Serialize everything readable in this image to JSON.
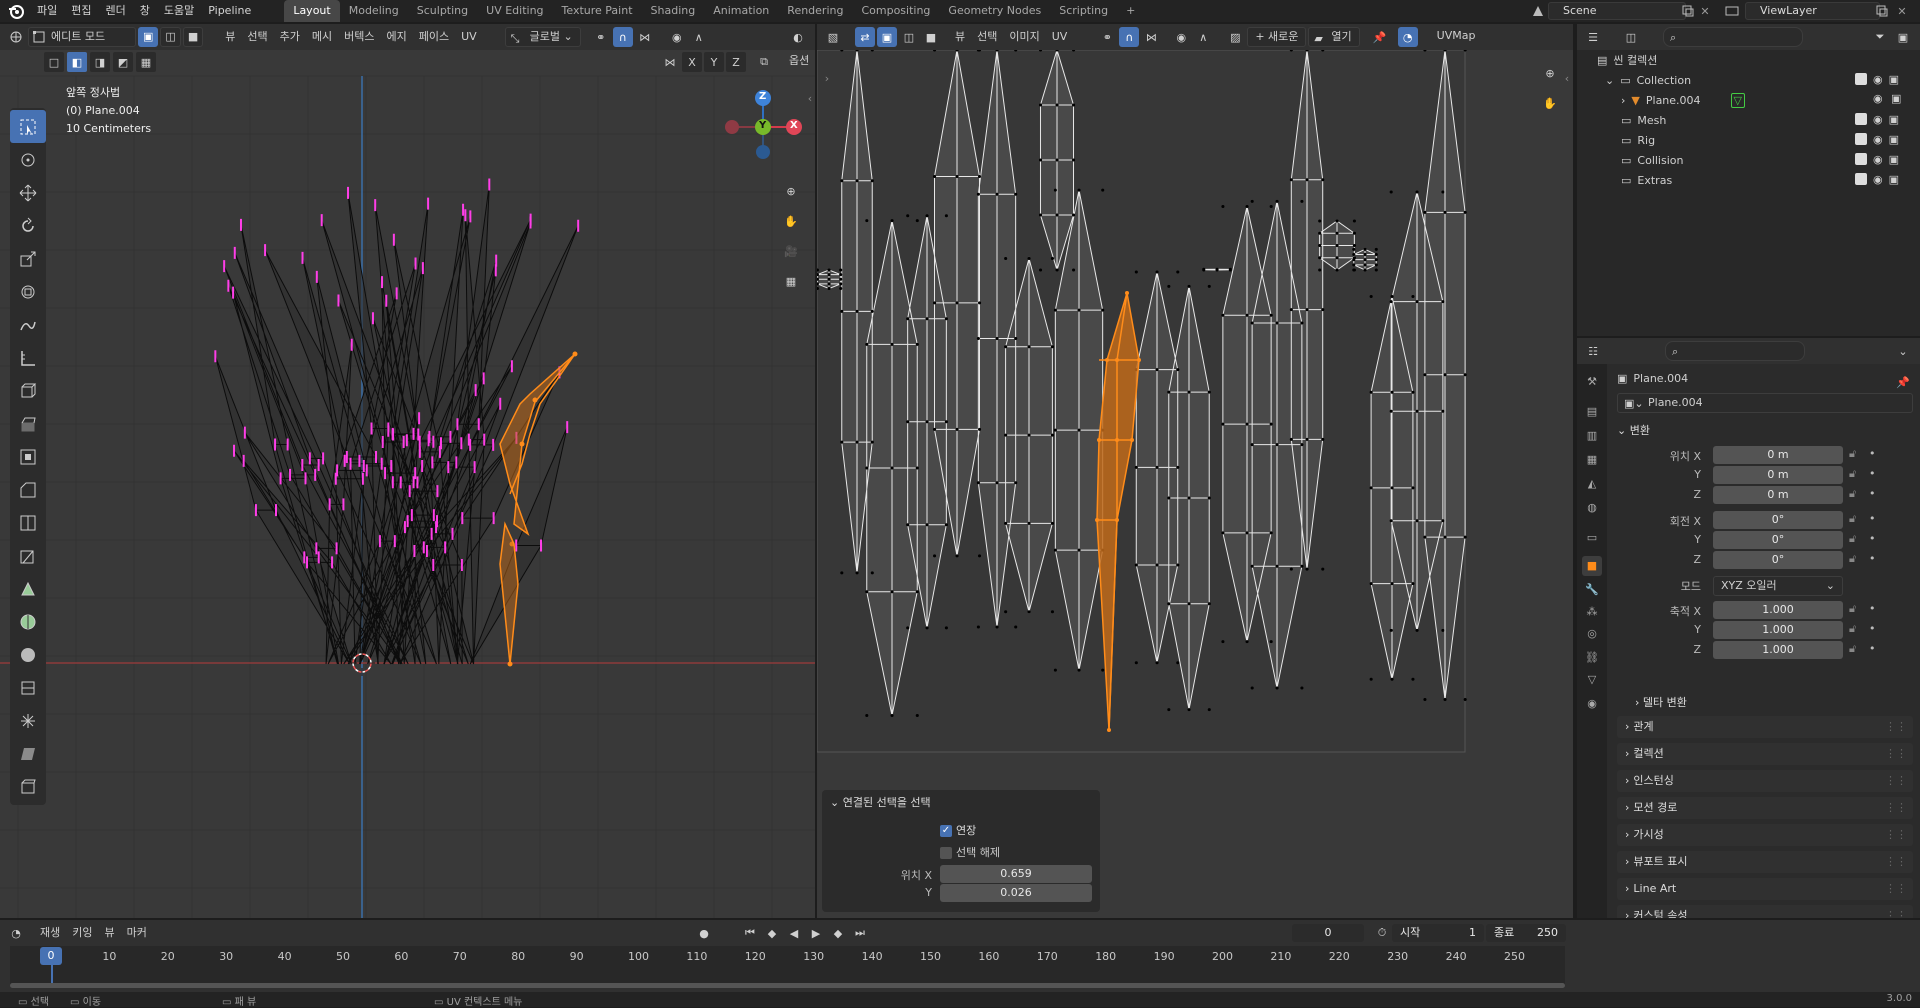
{
  "topbar": {
    "menus": [
      "파일",
      "편집",
      "렌더",
      "창",
      "도움말",
      "Pipeline"
    ],
    "workspaces": [
      "Layout",
      "Modeling",
      "Sculpting",
      "UV Editing",
      "Texture Paint",
      "Shading",
      "Animation",
      "Rendering",
      "Compositing",
      "Geometry Nodes",
      "Scripting"
    ],
    "active_workspace": "Layout",
    "add_tab": "+",
    "scene": "Scene",
    "view_layer": "ViewLayer"
  },
  "viewport": {
    "mode": "에디트 모드",
    "menus": [
      "뷰",
      "선택",
      "추가",
      "메시",
      "버텍스",
      "에지",
      "페이스",
      "UV"
    ],
    "transform_orientation": "글로벌",
    "options": "옵션",
    "axes": [
      "X",
      "Y",
      "Z"
    ],
    "overlay_title": "앞쪽 정사법",
    "overlay_object": "(0) Plane.004",
    "overlay_scale": "10 Centimeters",
    "gizmo": {
      "z": "Z",
      "y": "Y",
      "x": "X"
    }
  },
  "uv_editor": {
    "menus": [
      "뷰",
      "선택",
      "이미지",
      "UV"
    ],
    "new_btn": "+ 새로운",
    "open_btn": "열기",
    "uvmap": "UVMap"
  },
  "redo_panel": {
    "title": "연결된 선택을 선택",
    "extend_label": "연장",
    "extend_checked": true,
    "deselect_label": "선택 해제",
    "deselect_checked": false,
    "loc_x_label": "위치 X",
    "loc_x": "0.659",
    "loc_y_label": "Y",
    "loc_y": "0.026"
  },
  "outliner": {
    "scene_collection": "씬 컬렉션",
    "rows": [
      {
        "label": "Collection"
      },
      {
        "label": "Plane.004"
      },
      {
        "label": "Mesh"
      },
      {
        "label": "Rig"
      },
      {
        "label": "Collision"
      },
      {
        "label": "Extras"
      }
    ]
  },
  "properties": {
    "object_name": "Plane.004",
    "object_field": "Plane.004",
    "transform_title": "변환",
    "location_label": "위치 X",
    "location": [
      "0 m",
      "0 m",
      "0 m"
    ],
    "rotation_label": "회전 X",
    "rotation": [
      "0°",
      "0°",
      "0°"
    ],
    "mode_label": "모드",
    "mode_value": "XYZ 오일러",
    "scale_label": "축적 X",
    "scale": [
      "1.000",
      "1.000",
      "1.000"
    ],
    "y_label": "Y",
    "z_label": "Z",
    "delta_transform": "델타 변환",
    "sections": [
      "관계",
      "컬렉션",
      "인스턴싱",
      "모션 경로",
      "가시성",
      "뷰포트 표시",
      "Line Art",
      "커스텀 속성"
    ]
  },
  "timeline": {
    "menus": [
      "재생",
      "키잉",
      "뷰",
      "마커"
    ],
    "current_frame": "0",
    "start_label": "시작",
    "start": "1",
    "end_label": "종료",
    "end": "250",
    "ticks": [
      "0",
      "10",
      "20",
      "30",
      "40",
      "50",
      "60",
      "70",
      "80",
      "90",
      "100",
      "110",
      "120",
      "130",
      "140",
      "150",
      "160",
      "170",
      "180",
      "190",
      "200",
      "210",
      "220",
      "230",
      "240",
      "250"
    ]
  },
  "statusbar": {
    "items": [
      "선택",
      "이동",
      "패 뷰",
      "UV 컨텍스트 메뉴"
    ],
    "version": "3.0.0"
  },
  "colors": {
    "accent": "#4772b3",
    "selection": "#ff8c1a",
    "vertex_pink": "#ff3ee8"
  }
}
